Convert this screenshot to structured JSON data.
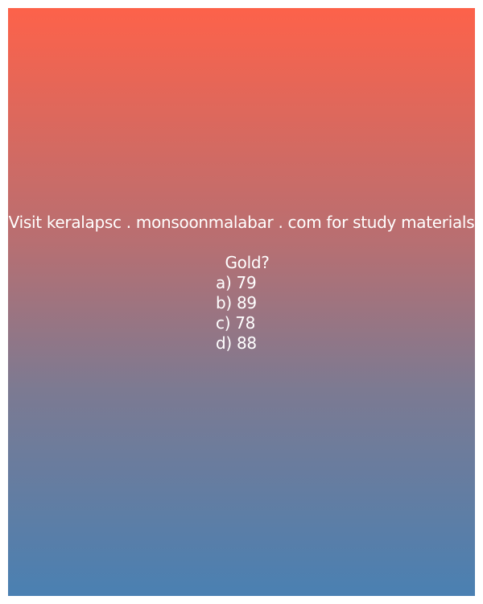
{
  "promo_text": "Visit keralapsc . monsoonmalabar . com for study materials",
  "question": "Gold?",
  "options": [
    "a) 79",
    "b) 89",
    "c) 78",
    "d) 88"
  ]
}
